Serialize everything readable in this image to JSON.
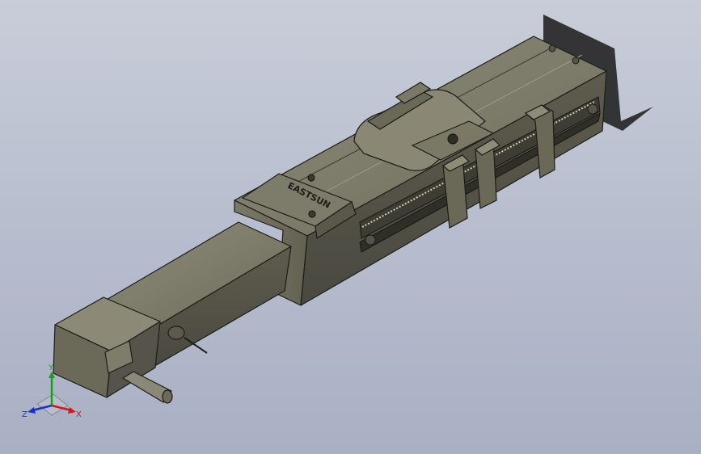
{
  "model": {
    "brand_text": "EASTSUN",
    "body_color": "#6e6c5c",
    "body_dark": "#4a493d",
    "body_light": "#8d8b79",
    "edge_color": "#1c1c18",
    "background_top": "#c9cdd9",
    "background_bottom": "#a9b0c4"
  },
  "triad": {
    "x_label": "X",
    "y_label": "Y",
    "z_label": "Z",
    "x_color": "#d01818",
    "y_color": "#18a018",
    "z_color": "#1830d0"
  }
}
